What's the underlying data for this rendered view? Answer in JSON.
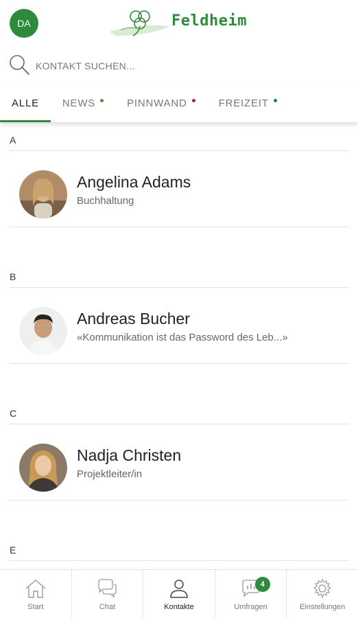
{
  "header": {
    "user_initials": "DA",
    "logo_text": "Feldheim",
    "accent_color": "#2e8b3c"
  },
  "search": {
    "placeholder": "KONTAKT SUCHEN..."
  },
  "tabs": [
    {
      "label": "ALLE",
      "active": true
    },
    {
      "label": "NEWS",
      "dot_color": "#5a8f3c"
    },
    {
      "label": "PINNWAND",
      "dot_color": "#b0202a"
    },
    {
      "label": "FREIZEIT",
      "dot_color": "#1f7a6e"
    }
  ],
  "sections": [
    {
      "letter": "A",
      "contact": {
        "name": "Angelina Adams",
        "subtitle": "Buchhaltung"
      }
    },
    {
      "letter": "B",
      "contact": {
        "name": "Andreas Bucher",
        "subtitle": "«Kommunikation ist das Password des Leb...»"
      }
    },
    {
      "letter": "C",
      "contact": {
        "name": "Nadja Christen",
        "subtitle": "Projektleiter/in"
      }
    },
    {
      "letter": "E"
    }
  ],
  "bottom_nav": [
    {
      "label": "Start",
      "icon": "home-icon"
    },
    {
      "label": "Chat",
      "icon": "chat-icon"
    },
    {
      "label": "Kontakte",
      "icon": "person-icon",
      "active": true
    },
    {
      "label": "Umfragen",
      "icon": "survey-icon",
      "badge": "4"
    },
    {
      "label": "Einstellungen",
      "icon": "gear-icon"
    }
  ]
}
